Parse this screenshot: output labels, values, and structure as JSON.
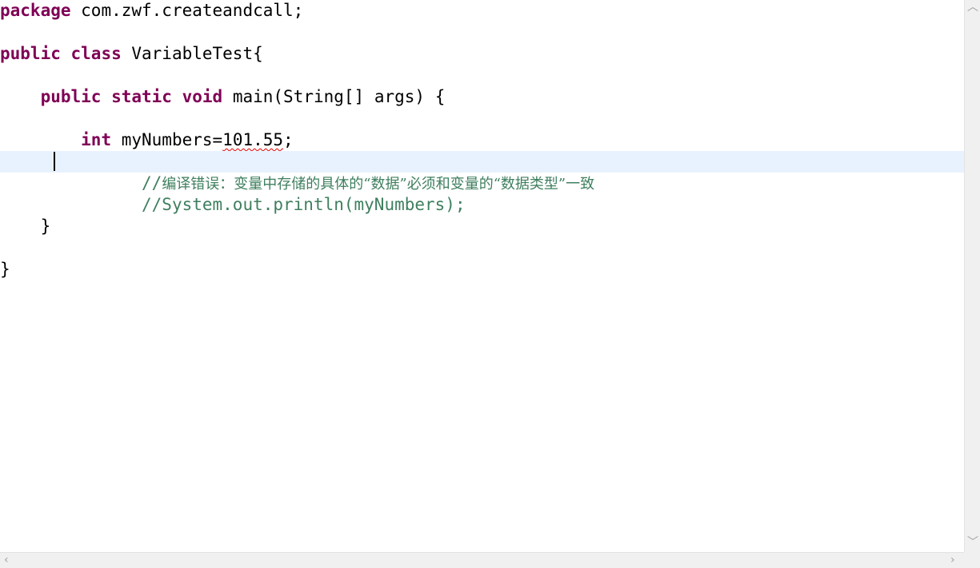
{
  "editor": {
    "lines": {
      "l1": {
        "kw1": "package",
        "rest": " com.zwf.createandcall;"
      },
      "l3": {
        "kw1": "public",
        "sp1": " ",
        "kw2": "class",
        "rest": " VariableTest{"
      },
      "l5": {
        "indent": "    ",
        "kw1": "public",
        "sp1": " ",
        "kw2": "static",
        "sp2": " ",
        "kw3": "void",
        "rest": " main(String[] args) {"
      },
      "l7": {
        "indent": "        ",
        "kw1": "int",
        "pre": " myNumbers=",
        "error": "101.55",
        "post": ";"
      },
      "l9": {
        "indent": "              ",
        "slashes": "//",
        "comment": "编译错误：变量中存储的具体的“数据”必须和变量的“数据类型”一致"
      },
      "l10": {
        "indent": "              ",
        "comment": "//System.out.println(myNumbers);"
      },
      "l11": {
        "text": "    }"
      },
      "l13": {
        "text": "}"
      }
    }
  },
  "scrollbars": {
    "up_icon": "chevron-up-icon",
    "down_icon": "chevron-down-icon",
    "left_icon": "chevron-left-icon",
    "right_icon": "chevron-right-icon"
  },
  "colors": {
    "keyword": "#7f0055",
    "comment": "#3f7f5f",
    "current_line": "#e8f2fe",
    "error_underline": "#e00000"
  }
}
